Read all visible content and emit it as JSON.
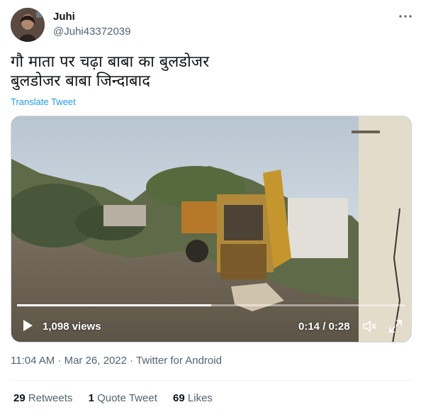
{
  "user": {
    "name": "Juhi",
    "handle": "@Juhi43372039"
  },
  "tweet": {
    "lines": [
      "गौ माता पर चढ़ा बाबा का बुलडोजर",
      "बुलडोजर बाबा जिन्दाबाद"
    ],
    "translate_label": "Translate Tweet"
  },
  "video": {
    "views": "1,098 views",
    "time": "0:14 / 0:28",
    "progress": 0.5
  },
  "meta": {
    "timestamp": "11:04 AM · Mar 26, 2022 · Twitter for Android"
  },
  "stats": {
    "retweets_count": "29",
    "retweets_label": "Retweets",
    "quotes_count": "1",
    "quotes_label": "Quote Tweet",
    "likes_count": "69",
    "likes_label": "Likes"
  },
  "colors": {
    "link": "#1d9bf0",
    "secondary_text": "#536471",
    "primary_text": "#0f1419"
  },
  "icons": [
    "more-icon",
    "play-icon",
    "volume-icon",
    "fullscreen-icon"
  ]
}
